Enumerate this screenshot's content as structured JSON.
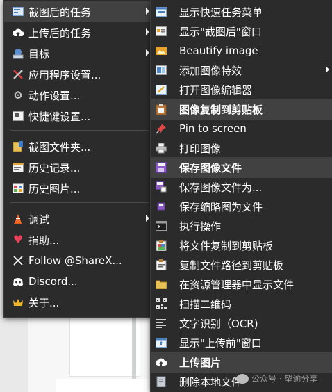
{
  "main_menu": {
    "items": [
      {
        "label": "截图后的任务",
        "icon": "capture-task-icon",
        "submenu": true
      },
      {
        "label": "上传后的任务",
        "icon": "cloud-upload-icon",
        "submenu": true
      },
      {
        "label": "目标",
        "icon": "destination-icon",
        "submenu": true
      },
      {
        "label": "应用程序设置...",
        "icon": "wrench-screwdriver-icon",
        "submenu": false
      },
      {
        "label": "动作设置...",
        "icon": "gear-icon",
        "submenu": false
      },
      {
        "label": "快捷键设置...",
        "icon": "keyboard-icon",
        "submenu": false
      },
      {
        "label": "截图文件夹...",
        "icon": "folder-icon",
        "submenu": false
      },
      {
        "label": "历史记录...",
        "icon": "history-icon",
        "submenu": false
      },
      {
        "label": "历史图片...",
        "icon": "image-history-icon",
        "submenu": false
      },
      {
        "label": "调试",
        "icon": "traffic-cone-icon",
        "submenu": true
      },
      {
        "label": "捐助...",
        "icon": "heart-icon",
        "submenu": false
      },
      {
        "label": "Follow @ShareX...",
        "icon": "x-logo-icon",
        "submenu": false
      },
      {
        "label": "Discord...",
        "icon": "discord-icon",
        "submenu": false
      },
      {
        "label": "关于...",
        "icon": "crown-icon",
        "submenu": false
      }
    ]
  },
  "sub_menu": {
    "items": [
      {
        "label": "显示快速任务菜单",
        "icon": "quick-task-menu-icon",
        "checked": false,
        "bold": false
      },
      {
        "label": "显示\"截图后\"窗口",
        "icon": "window-icon",
        "checked": false,
        "bold": false
      },
      {
        "label": "Beautify image",
        "icon": "beautify-icon",
        "checked": false,
        "bold": false
      },
      {
        "label": "添加图像特效",
        "icon": "effects-icon",
        "checked": false,
        "bold": false,
        "submenu": true
      },
      {
        "label": "打开图像编辑器",
        "icon": "image-editor-icon",
        "checked": false,
        "bold": false
      },
      {
        "label": "图像复制到剪贴板",
        "icon": "clipboard-image-icon",
        "checked": true,
        "bold": true
      },
      {
        "label": "Pin to screen",
        "icon": "pin-icon",
        "checked": false,
        "bold": false
      },
      {
        "label": "打印图像",
        "icon": "printer-icon",
        "checked": false,
        "bold": false
      },
      {
        "label": "保存图像文件",
        "icon": "save-icon",
        "checked": true,
        "bold": true
      },
      {
        "label": "保存图像文件为...",
        "icon": "save-as-icon",
        "checked": false,
        "bold": false
      },
      {
        "label": "保存缩略图为文件",
        "icon": "save-thumbnail-icon",
        "checked": false,
        "bold": false
      },
      {
        "label": "执行操作",
        "icon": "terminal-icon",
        "checked": false,
        "bold": false
      },
      {
        "label": "将文件复制到剪贴板",
        "icon": "copy-file-icon",
        "checked": false,
        "bold": false
      },
      {
        "label": "复制文件路径到剪贴板",
        "icon": "copy-path-icon",
        "checked": false,
        "bold": false
      },
      {
        "label": "在资源管理器中显示文件",
        "icon": "explorer-folder-icon",
        "checked": false,
        "bold": false
      },
      {
        "label": "扫描二维码",
        "icon": "qr-code-icon",
        "checked": false,
        "bold": false
      },
      {
        "label": "文字识别（OCR)",
        "icon": "ocr-icon",
        "checked": false,
        "bold": false
      },
      {
        "label": "显示\"上传前\"窗口",
        "icon": "before-upload-window-icon",
        "checked": false,
        "bold": false
      },
      {
        "label": "上传图片",
        "icon": "cloud-upload-icon",
        "checked": true,
        "bold": true
      },
      {
        "label": "删除本地文件",
        "icon": "delete-file-icon",
        "checked": false,
        "bold": false
      }
    ]
  },
  "watermark": {
    "text": "公众号 · 望逾分享"
  },
  "colors": {
    "menu_bg": "#2b2b2b",
    "highlight": "#414141",
    "text": "#ffffff"
  }
}
